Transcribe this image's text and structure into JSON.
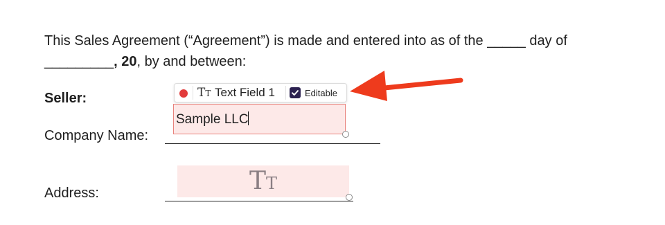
{
  "document": {
    "para_line1": "This Sales Agreement (“Agreement”) is made and entered into as of the _____ day of",
    "para_line2_blank": "_________",
    "para_line2_bold": ", 20",
    "para_line2_rest": ", by and between:",
    "seller_label": "Seller:",
    "company_label": "Company Name:",
    "address_label": "Address:"
  },
  "field_toolbar": {
    "type_icon": "text-type-icon",
    "field_name": "Text Field 1",
    "editable_label": "Editable",
    "editable_checked": true
  },
  "text_field": {
    "value": "Sample LLC"
  },
  "colors": {
    "field_fill": "#fde9e8",
    "field_border": "#e8827c",
    "recording_dot": "#e23b3b",
    "checkbox": "#2b2150",
    "arrow": "#ee3b1d"
  },
  "icons": {
    "record": "record-dot-icon",
    "check": "checkmark-icon",
    "placeholder": "text-type-icon",
    "annotation": "red-arrow-icon"
  }
}
